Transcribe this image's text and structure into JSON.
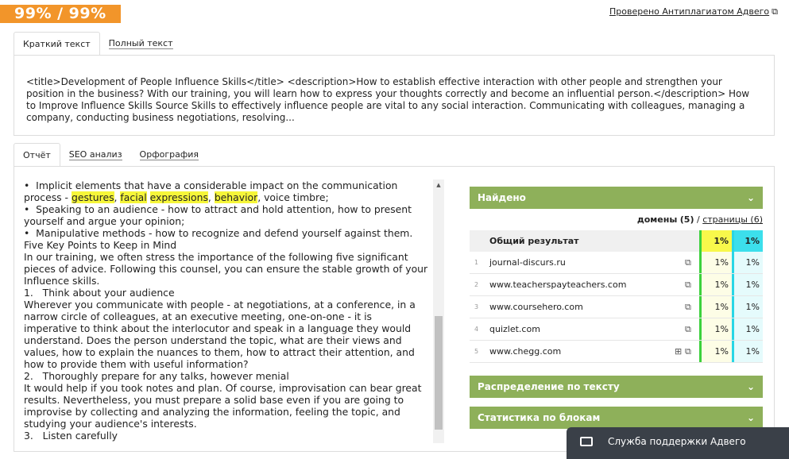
{
  "score": "99% / 99%",
  "verified_link": "Проверено Антиплагиатом Адвего",
  "top_tabs": [
    {
      "label": "Краткий текст",
      "active": true
    },
    {
      "label": "Полный текст",
      "active": false
    }
  ],
  "short_text": "<title>Development of People Influence Skills</title> <description>How to establish effective interaction with other people and strengthen your position in the business? With our training, you will learn how to express your thoughts correctly and become an influential person.</description> How to Improve Influence Skills Source Skills to effectively influence people are vital to any social interaction. Communicating with colleagues, managing a company, conducting business negotiations, resolving...",
  "report_tabs": [
    {
      "label": "Отчёт",
      "active": true
    },
    {
      "label": "SEO анализ",
      "active": false
    },
    {
      "label": "Орфография",
      "active": false
    }
  ],
  "report_text": {
    "line1": "•  Implicit elements that have a considerable impact on the communication",
    "line2_pre": "process - ",
    "hl1": "gestures",
    "sep1": ", ",
    "hl2": "facial",
    "sep2": " ",
    "hl3": "expressions",
    "sep3": ", ",
    "hl4": "behavior",
    "line2_post": ", voice timbre;",
    "rest": "•  Speaking to an audience - how to attract and hold attention, how to present\nyourself and argue your opinion;\n•  Manipulative methods - how to recognize and defend yourself against them.\nFive Key Points to Keep in Mind\nIn our training, we often stress the importance of the following five significant\npieces of advice. Following this counsel, you can ensure the stable growth of your\nInfluence skills.\n1.   Think about your audience\nWherever you communicate with people - at negotiations, at a conference, in a\nnarrow circle of colleagues, at an executive meeting, one-on-one - it is\nimperative to think about the interlocutor and speak in a language they would\nunderstand. Does the person understand the topic, what are their views and\nvalues, how to explain the nuances to them, how to attract their attention, and\nhow to provide them with useful information?\n2.   Thoroughly prepare for any talks, however menial\nIt would help if you took notes and plan. Of course, improvisation can bear great\nresults. Nevertheless, you must prepare a solid base even if you are going to\nimprovise by collecting and analyzing the information, feeling the topic, and\nstudying your audience's interests.\n3.   Listen carefully"
  },
  "found_section": {
    "title": "Найдено",
    "domains_label": "домены",
    "domains_count": "(5)",
    "divider": "/",
    "pages_label": "страницы (6)"
  },
  "results": {
    "header": {
      "label": "Общий результат",
      "p1": "1%",
      "p2": "1%"
    },
    "rows": [
      {
        "num": "1",
        "domain": "journal-discurs.ru",
        "p1": "1%",
        "p2": "1%"
      },
      {
        "num": "2",
        "domain": "www.teacherspayteachers.com",
        "p1": "1%",
        "p2": "1%"
      },
      {
        "num": "3",
        "domain": "www.coursehero.com",
        "p1": "1%",
        "p2": "1%"
      },
      {
        "num": "4",
        "domain": "quizlet.com",
        "p1": "1%",
        "p2": "1%"
      },
      {
        "num": "5",
        "domain": "www.chegg.com",
        "p1": "1%",
        "p2": "1%"
      }
    ]
  },
  "distribution_title": "Распределение по тексту",
  "blocks_title": "Статистика по блокам",
  "support_label": "Служба поддержки Адвего",
  "colors": {
    "badge": "#f2952a",
    "green": "#8eb05a",
    "highlight": "#f6f63a",
    "col1_border": "#3cd13c",
    "col2_border": "#28d6e6"
  }
}
